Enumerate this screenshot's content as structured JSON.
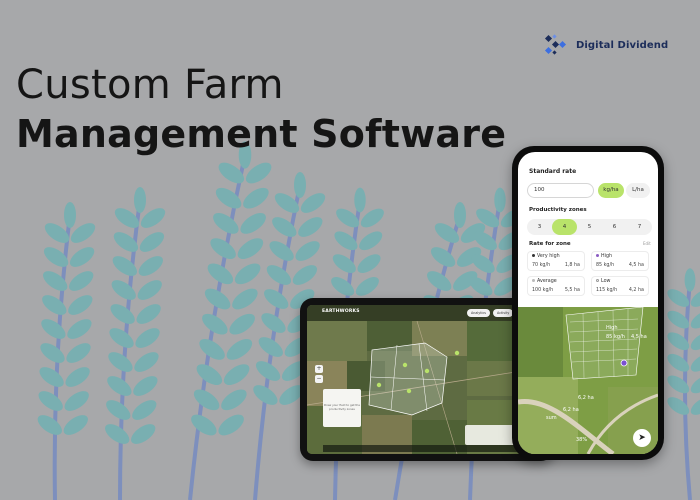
{
  "brand": {
    "name": "Digital Dividend"
  },
  "headline": {
    "line1": "Custom Farm",
    "line2": "Management Software"
  },
  "tablet": {
    "logo": "EARTHWORKS",
    "top_buttons": [
      "Analytics",
      "Activity",
      "Layers"
    ],
    "zoom_in": "+",
    "zoom_out": "−",
    "card_text": "Draw your field to get the productivity zones"
  },
  "phone": {
    "standard_rate_title": "Standard rate",
    "rate_value": "100",
    "units": [
      "kg/ha",
      "L/ha"
    ],
    "productivity_zones_title": "Productivity zones",
    "zones": [
      "3",
      "4",
      "5",
      "6",
      "7"
    ],
    "selected_zone": "4",
    "rate_for_zone_title": "Rate for zone",
    "edit_label": "Edit",
    "zone_rates": [
      {
        "name": "Very high",
        "rate": "70 kg/h",
        "area": "1,8 ha"
      },
      {
        "name": "High",
        "rate": "85 kg/h",
        "area": "4,5 ha"
      },
      {
        "name": "Average",
        "rate": "100 kg/h",
        "area": "5,5 ha"
      },
      {
        "name": "Low",
        "rate": "115 kg/h",
        "area": "4,2 ha"
      }
    ],
    "map_labels": {
      "high": "High",
      "high_rate": "85 kg/h",
      "high_area": "4,5 ha",
      "area2": "6,2 ha",
      "area3": "6,2 ha",
      "pct": "38%",
      "partial1": "ance",
      "partial2": "sum"
    },
    "nav_icon": "navigation-arrow-icon"
  },
  "colors": {
    "background": "#a7a8aa",
    "wheat_leaf": "#79afb1",
    "wheat_stem": "#7d8fbd",
    "accent_green": "#b9e36a",
    "brand_navy": "#1c2d5a",
    "brand_blue": "#3d6fe0"
  }
}
